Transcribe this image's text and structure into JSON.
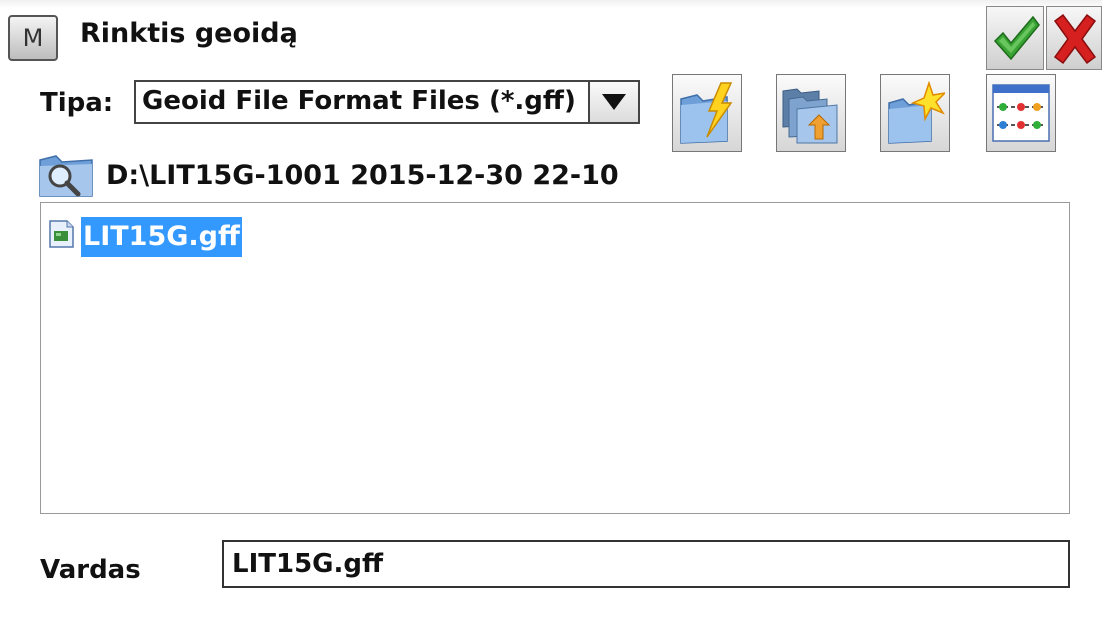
{
  "window": {
    "title": "Rinktis geoidą",
    "menu_icon": "M",
    "ok_icon": "green-checkmark-icon",
    "cancel_icon": "red-x-icon"
  },
  "type_filter": {
    "label": "Tipa:",
    "selected": "Geoid File Format Files (*.gff)"
  },
  "toolbar": {
    "buttons": [
      "folder-lightning-icon",
      "folder-up-icon",
      "new-folder-icon",
      "settings-list-icon"
    ]
  },
  "location": {
    "icon": "folder-search-icon",
    "path": "D:\\LIT15G-1001 2015-12-30 22-10"
  },
  "files": [
    {
      "name": "LIT15G.gff",
      "selected": true
    }
  ],
  "name_field": {
    "label": "Vardas",
    "value": "LIT15G.gff"
  },
  "colors": {
    "selection": "#3399ff",
    "ok": "#3aa335",
    "cancel": "#d62020"
  }
}
